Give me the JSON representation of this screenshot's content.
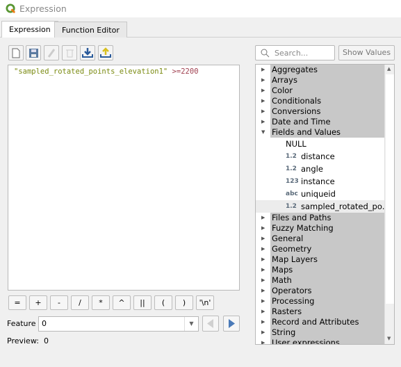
{
  "window": {
    "title": "Expression"
  },
  "tabs": [
    {
      "label": "Expression"
    },
    {
      "label": "Function Editor"
    }
  ],
  "toolbar": [
    "new-file-icon",
    "save-icon",
    "edit-icon",
    "delete-icon",
    "load-icon",
    "export-icon"
  ],
  "editor": {
    "field": "\"sampled_rotated_points_elevation1\"",
    "operator": " >=",
    "value": "2200"
  },
  "operators": [
    "=",
    "+",
    "-",
    "/",
    "*",
    "^",
    "||",
    "(",
    ")",
    "'\\n'"
  ],
  "feature": {
    "label": "Feature",
    "value": "0"
  },
  "preview": {
    "label": "Preview:",
    "value": "0"
  },
  "search": {
    "placeholder": "Search..."
  },
  "show_values": "Show Values",
  "tree": {
    "before": [
      "Aggregates",
      "Arrays",
      "Color",
      "Conditionals",
      "Conversions",
      "Date and Time"
    ],
    "expanded": "Fields and Values",
    "null": "NULL",
    "fields": [
      {
        "type": "1.2",
        "name": "distance"
      },
      {
        "type": "1.2",
        "name": "angle"
      },
      {
        "type": "123",
        "name": "instance"
      },
      {
        "type": "abc",
        "name": "uniqueid"
      },
      {
        "type": "1.2",
        "name": "sampled_rotated_po..."
      }
    ],
    "after": [
      "Files and Paths",
      "Fuzzy Matching",
      "General",
      "Geometry",
      "Map Layers",
      "Maps",
      "Math",
      "Operators",
      "Processing",
      "Rasters",
      "Record and Attributes",
      "String",
      "User expressions"
    ]
  },
  "colors": {
    "string": "#7a8a10",
    "operator": "#a04050",
    "category_bg": "#c8c8c8"
  }
}
